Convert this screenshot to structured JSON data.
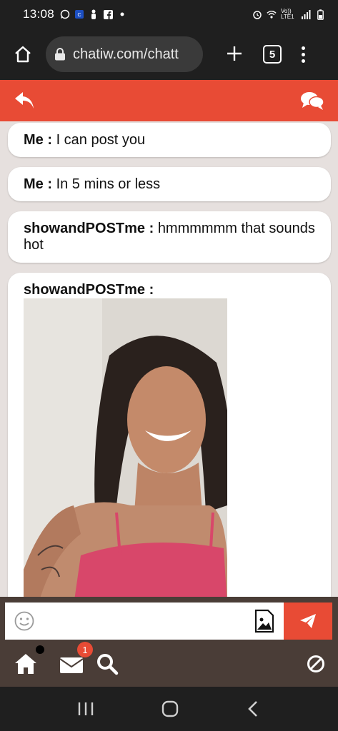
{
  "status_bar": {
    "time": "13:08",
    "network": "Vo)) LTE1"
  },
  "browser": {
    "url": "chatiw.com/chatt",
    "tab_count": "5"
  },
  "messages": [
    {
      "sender": "Me :",
      "text": "I can post you"
    },
    {
      "sender": "Me :",
      "text": "In 5 mins or less"
    },
    {
      "sender": "showandPOSTme :",
      "text": "hmmmmmm that sounds hot"
    },
    {
      "sender": "showandPOSTme :",
      "text": ""
    }
  ],
  "composer": {
    "placeholder": ""
  },
  "bottom_bar": {
    "mail_badge": "1"
  },
  "colors": {
    "accent": "#e84b35",
    "chat_bg": "#e6e0de",
    "bar_bg": "#4a3d37"
  }
}
